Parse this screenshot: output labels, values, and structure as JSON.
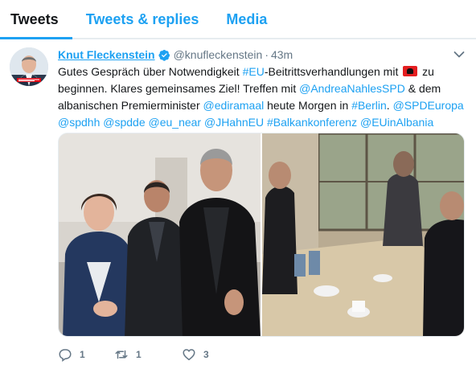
{
  "tabs": [
    "Tweets",
    "Tweets & replies",
    "Media"
  ],
  "tweet": {
    "name": "Knut Fleckenstein",
    "handle": "@knufleckenstein",
    "separator": "·",
    "time": "43m",
    "line1": {
      "t1": "Gutes Gespräch über Notwendigkeit ",
      "h1": "#EU",
      "t2": "-Beitrittsverhandlungen mit ",
      "t3": " zu"
    },
    "line2": {
      "t1": "beginnen. Klares gemeinsames Ziel! Treffen mit ",
      "m1": "@AndreaNahlesSPD",
      "t2": " & dem"
    },
    "line3": {
      "t1": "albanischen Premierminister ",
      "m1": "@ediramaal",
      "t2": " heute Morgen in ",
      "h1": "#Berlin",
      "t3": ". ",
      "m2": "@SPDEuropa"
    },
    "line4": {
      "m1": "@spdhh",
      "m2": "@spdde",
      "m3": "@eu_near",
      "m4": "@JHahnEU",
      "h1": "#Balkankonferenz",
      "m5": "@EUinAlbania"
    },
    "replies": "1",
    "retweets": "1",
    "likes": "3"
  },
  "icons": {
    "verified": "verified-badge-icon",
    "chevron": "chevron-down-icon",
    "reply": "reply-icon",
    "retweet": "retweet-icon",
    "like": "heart-icon",
    "flag": "albania-flag-icon"
  },
  "colors": {
    "accent": "#1da1f2",
    "text": "#14171a",
    "muted": "#657786",
    "flag": "#e41e20"
  }
}
